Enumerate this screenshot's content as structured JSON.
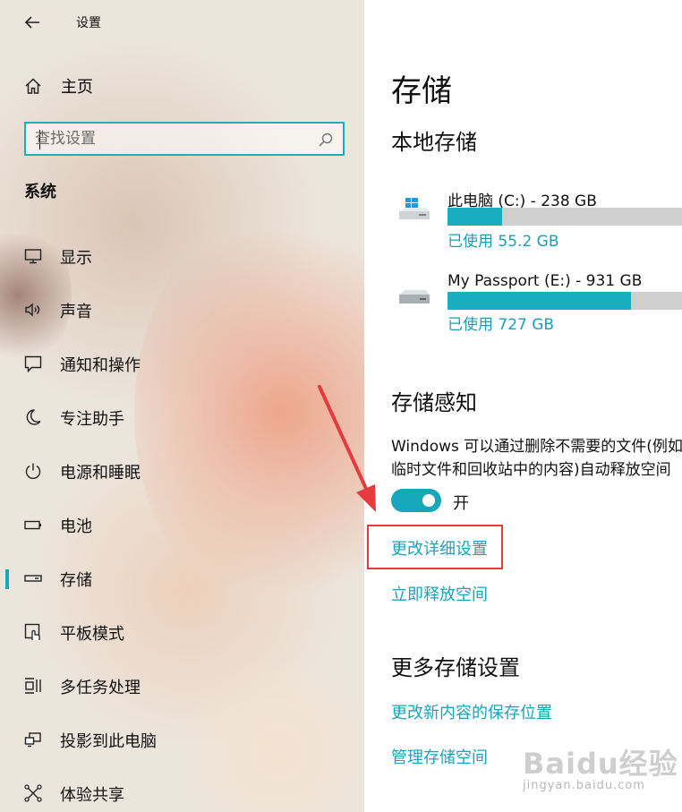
{
  "window": {
    "title": "设置",
    "back_icon": "back-arrow-icon"
  },
  "sidebar": {
    "home": {
      "label": "主页",
      "icon": "home-icon"
    },
    "search": {
      "placeholder": "查找设置",
      "icon": "search-icon"
    },
    "section_title": "系统",
    "items": [
      {
        "label": "显示",
        "icon": "monitor-icon"
      },
      {
        "label": "声音",
        "icon": "speaker-icon"
      },
      {
        "label": "通知和操作",
        "icon": "notification-icon"
      },
      {
        "label": "专注助手",
        "icon": "moon-icon"
      },
      {
        "label": "电源和睡眠",
        "icon": "power-icon"
      },
      {
        "label": "电池",
        "icon": "battery-icon"
      },
      {
        "label": "存储",
        "icon": "storage-drive-icon",
        "selected": true
      },
      {
        "label": "平板模式",
        "icon": "tablet-mode-icon"
      },
      {
        "label": "多任务处理",
        "icon": "multitasking-icon"
      },
      {
        "label": "投影到此电脑",
        "icon": "projecting-icon"
      },
      {
        "label": "体验共享",
        "icon": "share-icon"
      }
    ]
  },
  "main": {
    "title": "存储",
    "local_storage": {
      "heading": "本地存储",
      "drives": [
        {
          "name": "此电脑 (C:) - 238 GB",
          "used_text": "已使用 55.2 GB",
          "fill_fraction": 0.232,
          "icon": "windows-drive-icon"
        },
        {
          "name": "My Passport (E:) - 931 GB",
          "used_text": "已使用 727 GB",
          "fill_fraction": 0.781,
          "icon": "external-drive-icon"
        }
      ]
    },
    "storage_sense": {
      "heading": "存储感知",
      "description": "Windows 可以通过删除不需要的文件(例如临时文件和回收站中的内容)自动释放空间",
      "toggle_state": "开",
      "toggle_on": true,
      "link_change_settings": "更改详细设置",
      "link_free_space": "立即释放空间"
    },
    "more_settings": {
      "heading": "更多存储设置",
      "link_new_content": "更改新内容的保存位置",
      "link_manage_spaces": "管理存储空间"
    }
  },
  "watermark": {
    "logo_text": "Baidu经验",
    "url": "jingyan.baidu.com"
  },
  "colors": {
    "accent": "#17a7bb",
    "highlight_box": "#e53b3f",
    "bar_empty": "#cfcfcf"
  }
}
